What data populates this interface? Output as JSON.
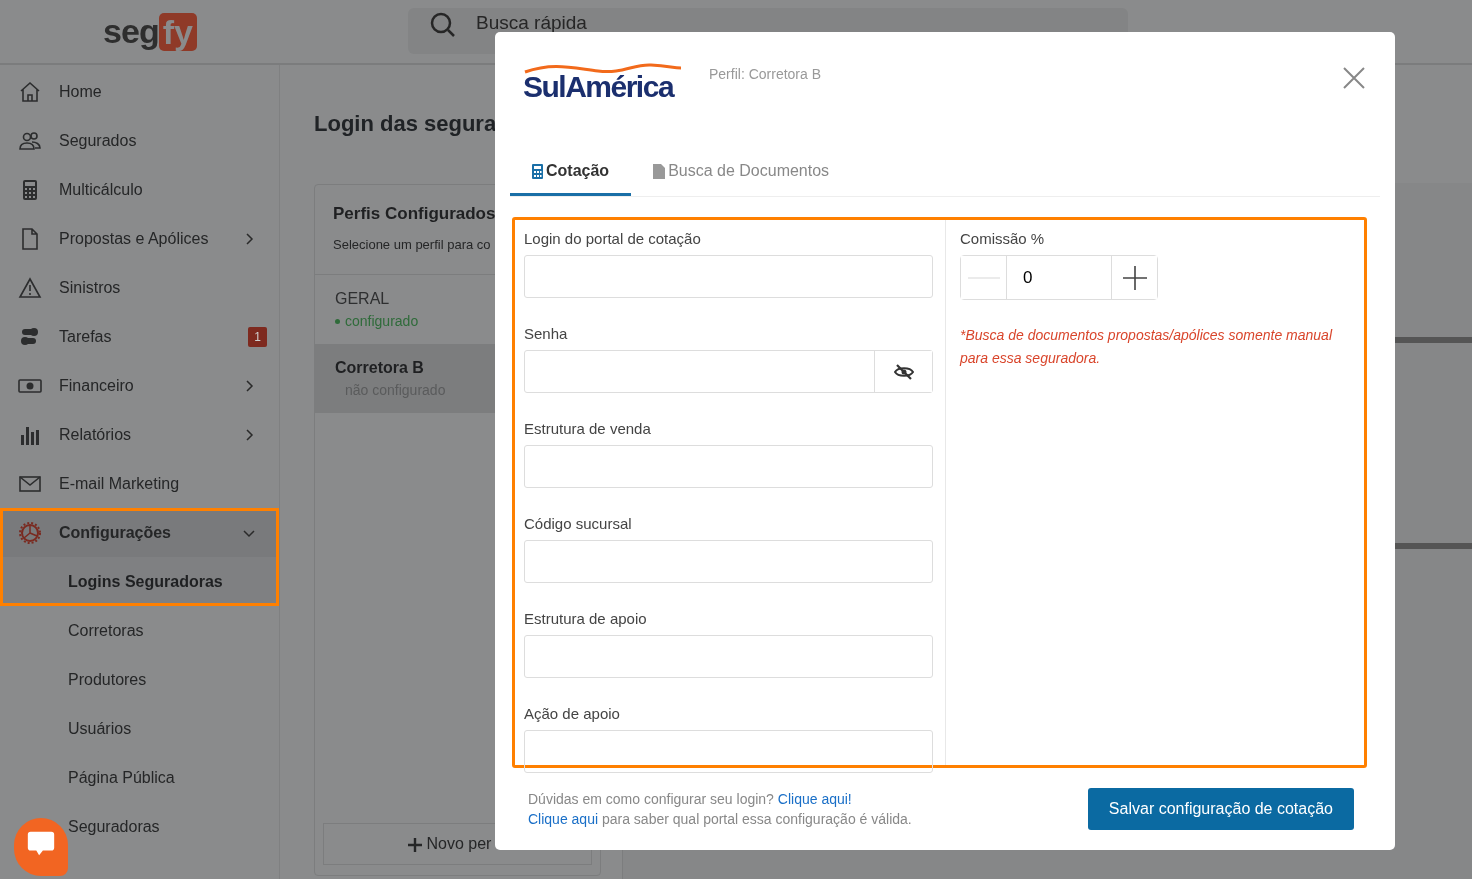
{
  "header": {
    "logo": [
      "seg",
      "fy"
    ],
    "search": {
      "placeholder": "Busca rápida"
    }
  },
  "sidebar": {
    "items": [
      {
        "label": "Home",
        "submenu": false,
        "highlighted": false
      },
      {
        "label": "Segurados",
        "submenu": false,
        "highlighted": false
      },
      {
        "label": "Multicálculo",
        "submenu": false,
        "highlighted": false
      },
      {
        "label": "Propostas e Apólices",
        "submenu": true,
        "expanded": false,
        "highlighted": false
      },
      {
        "label": "Sinistros",
        "submenu": false,
        "highlighted": false
      },
      {
        "label": "Tarefas",
        "submenu": false,
        "badge": "1",
        "highlighted": false
      },
      {
        "label": "Financeiro",
        "submenu": true,
        "expanded": false,
        "highlighted": false
      },
      {
        "label": "Relatórios",
        "submenu": true,
        "expanded": false,
        "highlighted": false
      },
      {
        "label": "E-mail Marketing",
        "submenu": false,
        "highlighted": false
      },
      {
        "label": "Configurações",
        "submenu": true,
        "expanded": true,
        "highlighted": true,
        "children": [
          {
            "label": "Logins Seguradoras",
            "selected": true
          },
          {
            "label": "Corretoras",
            "selected": false
          },
          {
            "label": "Produtores",
            "selected": false
          },
          {
            "label": "Usuários",
            "selected": false
          },
          {
            "label": "Página Pública",
            "selected": false
          },
          {
            "label": "Seguradoras",
            "selected": false
          }
        ]
      }
    ]
  },
  "main": {
    "title": "Login das segura",
    "profiles_card": {
      "title": "Perfis Configurados",
      "subtitle": "Selecione um perfil para co",
      "profiles": [
        {
          "name": "GERAL",
          "status": "configurado",
          "configured": true,
          "selected": false
        },
        {
          "name": "Corretora B",
          "status": "não configurado",
          "configured": false,
          "selected": true
        }
      ],
      "add_button": "Novo per"
    }
  },
  "modal": {
    "logo": "SulAmérica",
    "profile": "Perfil: Corretora B",
    "tabs": [
      {
        "label": "Cotação",
        "selected": true
      },
      {
        "label": "Busca de Documentos",
        "selected": false
      }
    ],
    "form": {
      "highlighted": true,
      "fields": [
        {
          "label": "Login do portal de cotação",
          "kind": "text"
        },
        {
          "label": "Senha",
          "kind": "password"
        },
        {
          "label": "Estrutura de venda",
          "kind": "text"
        },
        {
          "label": "Código sucursal",
          "kind": "text"
        },
        {
          "label": "Estrutura de apoio",
          "kind": "text"
        },
        {
          "label": "Ação de apoio",
          "kind": "text"
        }
      ],
      "commission": {
        "label": "Comissão %",
        "value": "0"
      },
      "note": "*Busca de documentos propostas/apólices somente manual para essa seguradora."
    },
    "help": [
      [
        {
          "kind": "text",
          "text": "Dúvidas em como configurar seu login?"
        },
        {
          "kind": "link",
          "text": "Clique aqui!"
        }
      ],
      [
        {
          "kind": "link",
          "text": "Clique aqui"
        },
        {
          "kind": "text",
          "text": "para saber qual portal essa configuração é válida."
        }
      ]
    ],
    "save_button": "Salvar configuração de cotação"
  }
}
